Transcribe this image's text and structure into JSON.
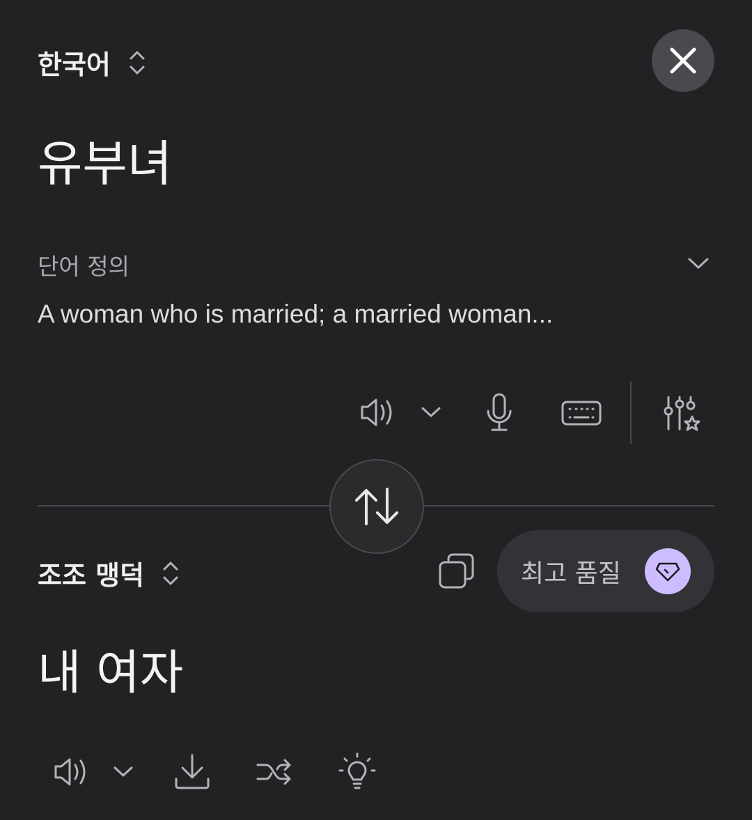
{
  "source": {
    "language": "한국어",
    "text": "유부녀",
    "definition_title": "단어 정의",
    "definition_text": "A woman who is married; a married woman..."
  },
  "target": {
    "language": "조조 맹덕",
    "text": "내 여자",
    "quality_label": "최고 품질"
  },
  "icons": {
    "close": "close-icon",
    "language_switch": "chevron-up-down-icon",
    "expand": "chevron-down-icon",
    "speaker": "speaker-icon",
    "mic": "microphone-icon",
    "keyboard": "keyboard-icon",
    "settings": "sliders-star-icon",
    "swap": "swap-arrows-icon",
    "copy": "copy-icon",
    "gem": "gem-icon",
    "download": "download-icon",
    "shuffle": "shuffle-icon",
    "idea": "lightbulb-icon"
  },
  "colors": {
    "background": "#222225",
    "accent_badge": "#cdbcff",
    "pill": "#333337"
  }
}
